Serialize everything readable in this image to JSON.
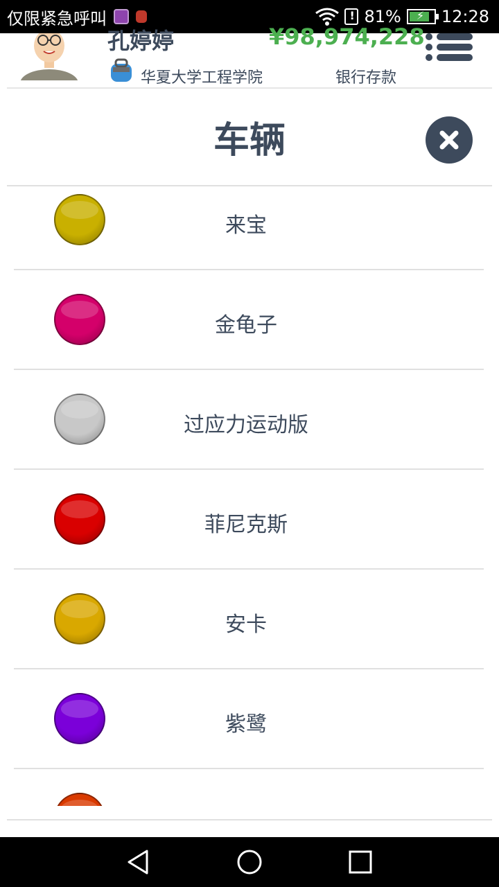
{
  "status_bar": {
    "carrier": "仅限紧急呼叫",
    "battery": "81%",
    "time": "12:28",
    "battery_level": 0.81
  },
  "header": {
    "player_name": "孔婷婷",
    "money": "¥98,974,228",
    "school": "华夏大学工程学院",
    "bank_label": "银行存款",
    "menu_icon": "list-menu-icon"
  },
  "dialog": {
    "title": "车辆",
    "close_icon": "close-icon"
  },
  "vehicles": [
    {
      "label": "来宝",
      "color": "#c9b000"
    },
    {
      "label": "金龟子",
      "color": "#d4006a"
    },
    {
      "label": "过应力运动版",
      "color": "#c8c8c8"
    },
    {
      "label": "菲尼克斯",
      "color": "#d90000"
    },
    {
      "label": "安卡",
      "color": "#d9a800"
    },
    {
      "label": "紫鹭",
      "color": "#7b00d9"
    },
    {
      "label": "",
      "color": "#d93a00"
    }
  ],
  "nav": {
    "back_icon": "back-triangle-icon",
    "home_icon": "home-circle-icon",
    "recents_icon": "recents-square-icon"
  }
}
